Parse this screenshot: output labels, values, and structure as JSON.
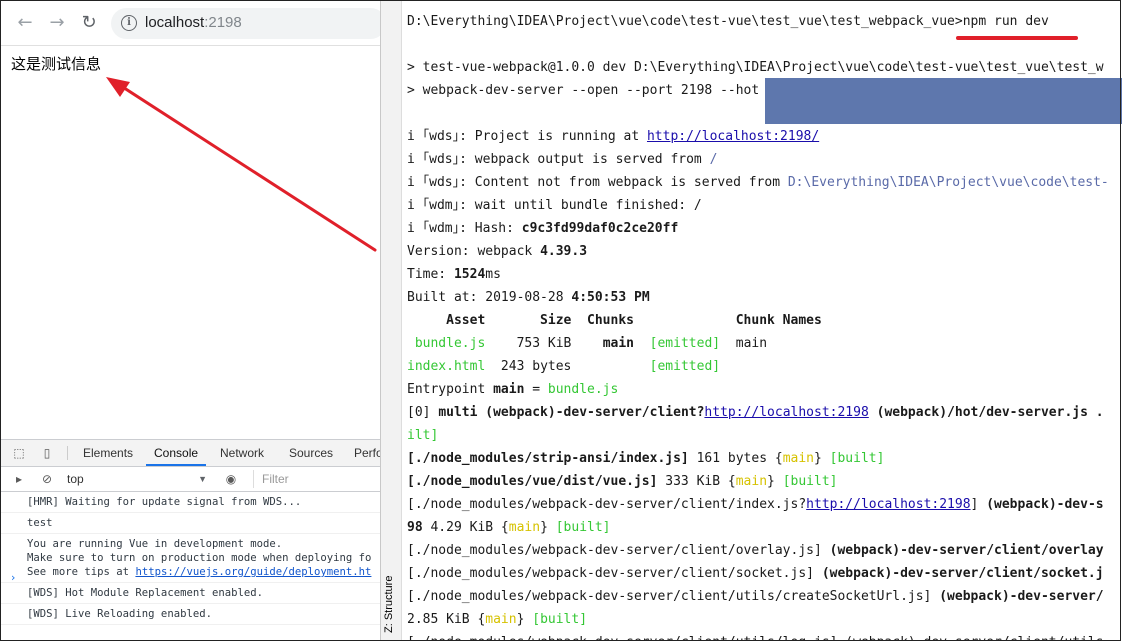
{
  "browser": {
    "url_host": "localhost",
    "url_port": ":2198",
    "page_text": "这是测试信息",
    "nav": {
      "back": "←",
      "forward": "→",
      "reload": "↻",
      "info": "i"
    }
  },
  "devtools": {
    "tabs": [
      "Elements",
      "Console",
      "Network",
      "Sources",
      "Perfo"
    ],
    "active_tab": "Console",
    "context": "top",
    "filter_placeholder": "Filter",
    "messages": [
      {
        "text": "[HMR] Waiting for update signal from WDS..."
      },
      {
        "text": "test"
      },
      {
        "text": "You are running Vue in development mode.\nMake sure to turn on production mode when deploying fo\nSee more tips at ",
        "link": "https://vuejs.org/guide/deployment.ht"
      },
      {
        "text": "[WDS] Hot Module Replacement enabled."
      },
      {
        "text": "[WDS] Live Reloading enabled."
      }
    ],
    "prompt": "›"
  },
  "terminal": {
    "side_label": "Z: Structure",
    "cmd_prompt": "D:\\Everything\\IDEA\\Project\\vue\\code\\test-vue\\test_vue\\test_webpack_vue>",
    "cmd": "npm run dev",
    "npm_line1": "> test-vue-webpack@1.0.0 dev D:\\Everything\\IDEA\\Project\\vue\\code\\test-vue\\test_vue\\test_w",
    "npm_line2": "> webpack-dev-server --open --port 2198 --hot",
    "wds1_a": "i ｢wds｣: Project is running at ",
    "wds1_link": "http://localhost:2198/",
    "wds2_a": "i ｢wds｣: webpack output is served from ",
    "wds2_b": "/",
    "wds3_a": "i ｢wds｣: Content not from webpack is served from ",
    "wds3_b": "D:\\Everything\\IDEA\\Project\\vue\\code\\test-",
    "wdm1": "i ｢wdm｣: wait until bundle finished: /",
    "wdm2_a": "i ｢wdm｣: Hash: ",
    "wdm2_b": "c9c3fd99daf0c2ce20ff",
    "version_a": "Version: webpack ",
    "version_b": "4.39.3",
    "time_a": "Time: ",
    "time_b": "1524",
    "time_c": "ms",
    "built_a": "Built at: 2019-08-28 ",
    "built_b": "4:50:53 PM",
    "table_header": "     Asset       Size  Chunks             Chunk Names",
    "row1_name": " bundle.js",
    "row1_size": "    753 KiB    ",
    "row1_chunk": "main",
    "row1_emit": "[emitted]",
    "row1_names": "main",
    "row2_name": "index.html",
    "row2_size": "  243 bytes          ",
    "row2_emit": "[emitted]",
    "entry_a": "Entrypoint ",
    "entry_b": "main",
    "entry_c": " = ",
    "entry_d": "bundle.js",
    "m0_a": "[0] ",
    "m0_b": "multi (webpack)-dev-server/client?",
    "m0_link": "http://localhost:2198",
    "m0_c": " (webpack)/hot/dev-server.js .",
    "m0_d": "ilt]",
    "m1_a": "[./node_modules/strip-ansi/index.js]",
    "m1_b": " 161 bytes {",
    "m1_c": "main",
    "m1_d": "} ",
    "m1_e": "[built]",
    "m2_a": "[./node_modules/vue/dist/vue.js]",
    "m2_b": " 333 KiB {",
    "m2_c": "main",
    "m2_d": "} ",
    "m2_e": "[built]",
    "m3_a": "[./node_modules/webpack-dev-server/client/index.js?",
    "m3_link": "http://localhost:2198",
    "m3_b": "] ",
    "m3_c": "(webpack)-dev-s",
    "m3_d": "98",
    "m3_e": " 4.29 KiB {",
    "m3_f": "main",
    "m3_g": "} ",
    "m3_h": "[built]",
    "m4_a": "[./node_modules/webpack-dev-server/client/overlay.js]",
    "m4_b": " (webpack)-dev-server/client/overlay",
    "m5_a": "[./node_modules/webpack-dev-server/client/socket.js]",
    "m5_b": " (webpack)-dev-server/client/socket.j",
    "m6_a": "[./node_modules/webpack-dev-server/client/utils/createSocketUrl.js]",
    "m6_b": " (webpack)-dev-server/",
    "m7_a": "2.85 KiB {",
    "m7_b": "main",
    "m7_c": "} ",
    "m7_d": "[built]",
    "m8": "[./node_modules/webpack-dev-server/client/utils/log.js] (webpack)-dev-server/client/utils"
  },
  "colors": {
    "annotation": "#e0202a",
    "selection": "#5e77ad",
    "ok": "#34c734",
    "chunk": "#d6c200"
  }
}
